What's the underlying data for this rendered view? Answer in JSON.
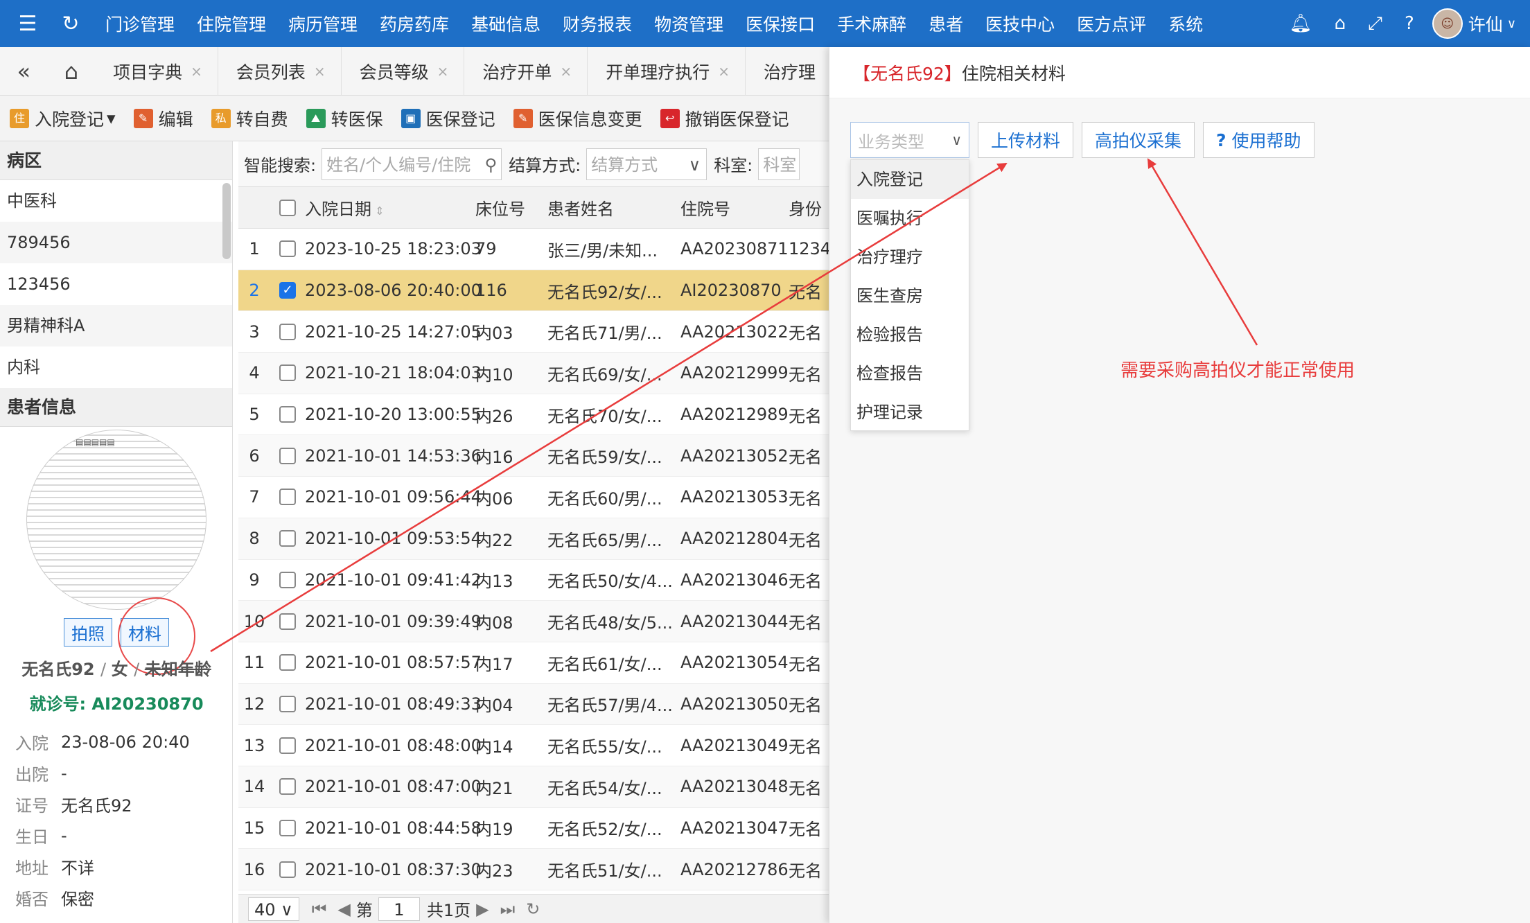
{
  "topnav": {
    "menu": [
      "门诊管理",
      "住院管理",
      "病历管理",
      "药房药库",
      "基础信息",
      "财务报表",
      "物资管理",
      "医保接口",
      "手术麻醉",
      "患者",
      "医技中心",
      "医方点评",
      "系统"
    ],
    "user": "许仙"
  },
  "tabs": [
    {
      "label": "项目字典"
    },
    {
      "label": "会员列表"
    },
    {
      "label": "会员等级"
    },
    {
      "label": "治疗开单"
    },
    {
      "label": "开单理疗执行"
    },
    {
      "label": "治疗理"
    }
  ],
  "toolbar": [
    "入院登记",
    "编辑",
    "转自费",
    "转医保",
    "医保登记",
    "医保信息变更",
    "撤销医保登记"
  ],
  "ward": {
    "title": "病区",
    "items": [
      "中医科",
      "789456",
      "123456",
      "男精神科A",
      "内科"
    ]
  },
  "patient": {
    "section_title": "患者信息",
    "photo_btn": "拍照",
    "material_btn": "材料",
    "name": "无名氏92",
    "gender": "女",
    "age": "未知年龄",
    "visit_label": "就诊号:",
    "visit_no": "AI20230870",
    "info": [
      {
        "k": "入院",
        "v": "23-08-06 20:40"
      },
      {
        "k": "出院",
        "v": "-"
      },
      {
        "k": "证号",
        "v": "无名氏92"
      },
      {
        "k": "生日",
        "v": "-"
      },
      {
        "k": "地址",
        "v": "不详"
      },
      {
        "k": "婚否",
        "v": "保密"
      }
    ]
  },
  "search": {
    "smart_label": "智能搜索:",
    "smart_placeholder": "姓名/个人编号/住院",
    "settle_label": "结算方式:",
    "settle_placeholder": "结算方式",
    "dept_label": "科室:",
    "dept_placeholder": "科室"
  },
  "table": {
    "headers": [
      "入院日期",
      "床位号",
      "患者姓名",
      "住院号",
      "身份"
    ],
    "rows": [
      {
        "n": "1",
        "date": "2023-10-25 18:23:03",
        "bed": "79",
        "name": "张三/男/未知...",
        "id": "AA20230871",
        "s": "1234"
      },
      {
        "n": "2",
        "date": "2023-08-06 20:40:00",
        "bed": "116",
        "name": "无名氏92/女/...",
        "id": "AI20230870",
        "s": "无名"
      },
      {
        "n": "3",
        "date": "2021-10-25 14:27:05",
        "bed": "内03",
        "name": "无名氏71/男/...",
        "id": "AA20213022",
        "s": "无名"
      },
      {
        "n": "4",
        "date": "2021-10-21 18:04:03",
        "bed": "内10",
        "name": "无名氏69/女/...",
        "id": "AA20212999",
        "s": "无名"
      },
      {
        "n": "5",
        "date": "2021-10-20 13:00:55",
        "bed": "内26",
        "name": "无名氏70/女/...",
        "id": "AA20212989",
        "s": "无名"
      },
      {
        "n": "6",
        "date": "2021-10-01 14:53:36",
        "bed": "内16",
        "name": "无名氏59/女/...",
        "id": "AA20213052",
        "s": "无名"
      },
      {
        "n": "7",
        "date": "2021-10-01 09:56:44",
        "bed": "内06",
        "name": "无名氏60/男/...",
        "id": "AA20213053",
        "s": "无名"
      },
      {
        "n": "8",
        "date": "2021-10-01 09:53:54",
        "bed": "内22",
        "name": "无名氏65/男/...",
        "id": "AA20212804",
        "s": "无名"
      },
      {
        "n": "9",
        "date": "2021-10-01 09:41:42",
        "bed": "内13",
        "name": "无名氏50/女/4...",
        "id": "AA20213046",
        "s": "无名"
      },
      {
        "n": "10",
        "date": "2021-10-01 09:39:49",
        "bed": "内08",
        "name": "无名氏48/女/5...",
        "id": "AA20213044",
        "s": "无名"
      },
      {
        "n": "11",
        "date": "2021-10-01 08:57:57",
        "bed": "内17",
        "name": "无名氏61/女/...",
        "id": "AA20213054",
        "s": "无名"
      },
      {
        "n": "12",
        "date": "2021-10-01 08:49:33",
        "bed": "内04",
        "name": "无名氏57/男/4...",
        "id": "AA20213050",
        "s": "无名"
      },
      {
        "n": "13",
        "date": "2021-10-01 08:48:00",
        "bed": "内14",
        "name": "无名氏55/女/...",
        "id": "AA20213049",
        "s": "无名"
      },
      {
        "n": "14",
        "date": "2021-10-01 08:47:00",
        "bed": "内21",
        "name": "无名氏54/女/...",
        "id": "AA20213048",
        "s": "无名"
      },
      {
        "n": "15",
        "date": "2021-10-01 08:44:58",
        "bed": "内19",
        "name": "无名氏52/女/...",
        "id": "AA20213047",
        "s": "无名"
      },
      {
        "n": "16",
        "date": "2021-10-01 08:37:30",
        "bed": "内23",
        "name": "无名氏51/女/...",
        "id": "AA20212786",
        "s": "无名"
      }
    ]
  },
  "pager": {
    "size": "40",
    "page_prefix": "第",
    "page": "1",
    "total": "共1页"
  },
  "rpanel": {
    "title_red": "【无名氏92】",
    "title": "住院相关材料",
    "select_placeholder": "业务类型",
    "upload": "上传材料",
    "camera": "高拍仪采集",
    "help": "使用帮助",
    "dropdown": [
      "入院登记",
      "医嘱执行",
      "治疗理疗",
      "医生查房",
      "检验报告",
      "检查报告",
      "护理记录"
    ],
    "note": "需要采购高拍仪才能正常使用"
  }
}
